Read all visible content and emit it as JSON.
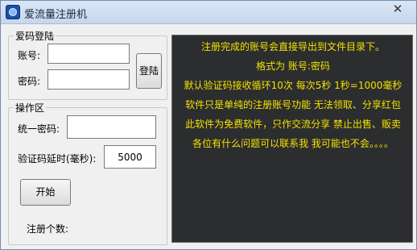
{
  "window": {
    "title": "爱流量注册机",
    "close_glyph": "✕"
  },
  "login_group": {
    "legend": "爱码登陆",
    "account_label": "账号:",
    "account_value": "",
    "password_label": "密码:",
    "password_value": "",
    "login_button": "登陆"
  },
  "ops_group": {
    "legend": "操作区",
    "unified_password_label": "统一密码:",
    "unified_password_value": "",
    "delay_label": "验证码延时(毫秒):",
    "delay_value": "5000",
    "start_button": "开始",
    "reg_count_label": "注册个数:"
  },
  "notice": {
    "lines": [
      "注册完成的账号会直接导出到文件目录下。",
      "格式为 账号:密码",
      "默认验证码接收循环10次  每次5秒  1秒=1000毫秒",
      "软件只是单纯的注册账号功能 无法领取、分享红包",
      "此软件为免费软件，只作交流分享 禁止出售、贩卖",
      "各位有什么问题可以联系我 我可能也不会。。。。"
    ]
  },
  "colors": {
    "notice_text": "#f5e100",
    "notice_bg": "#2b2d2f",
    "window_bg": "#f0f0f0"
  },
  "icons": {
    "app": "app-icon",
    "close": "close-icon"
  }
}
